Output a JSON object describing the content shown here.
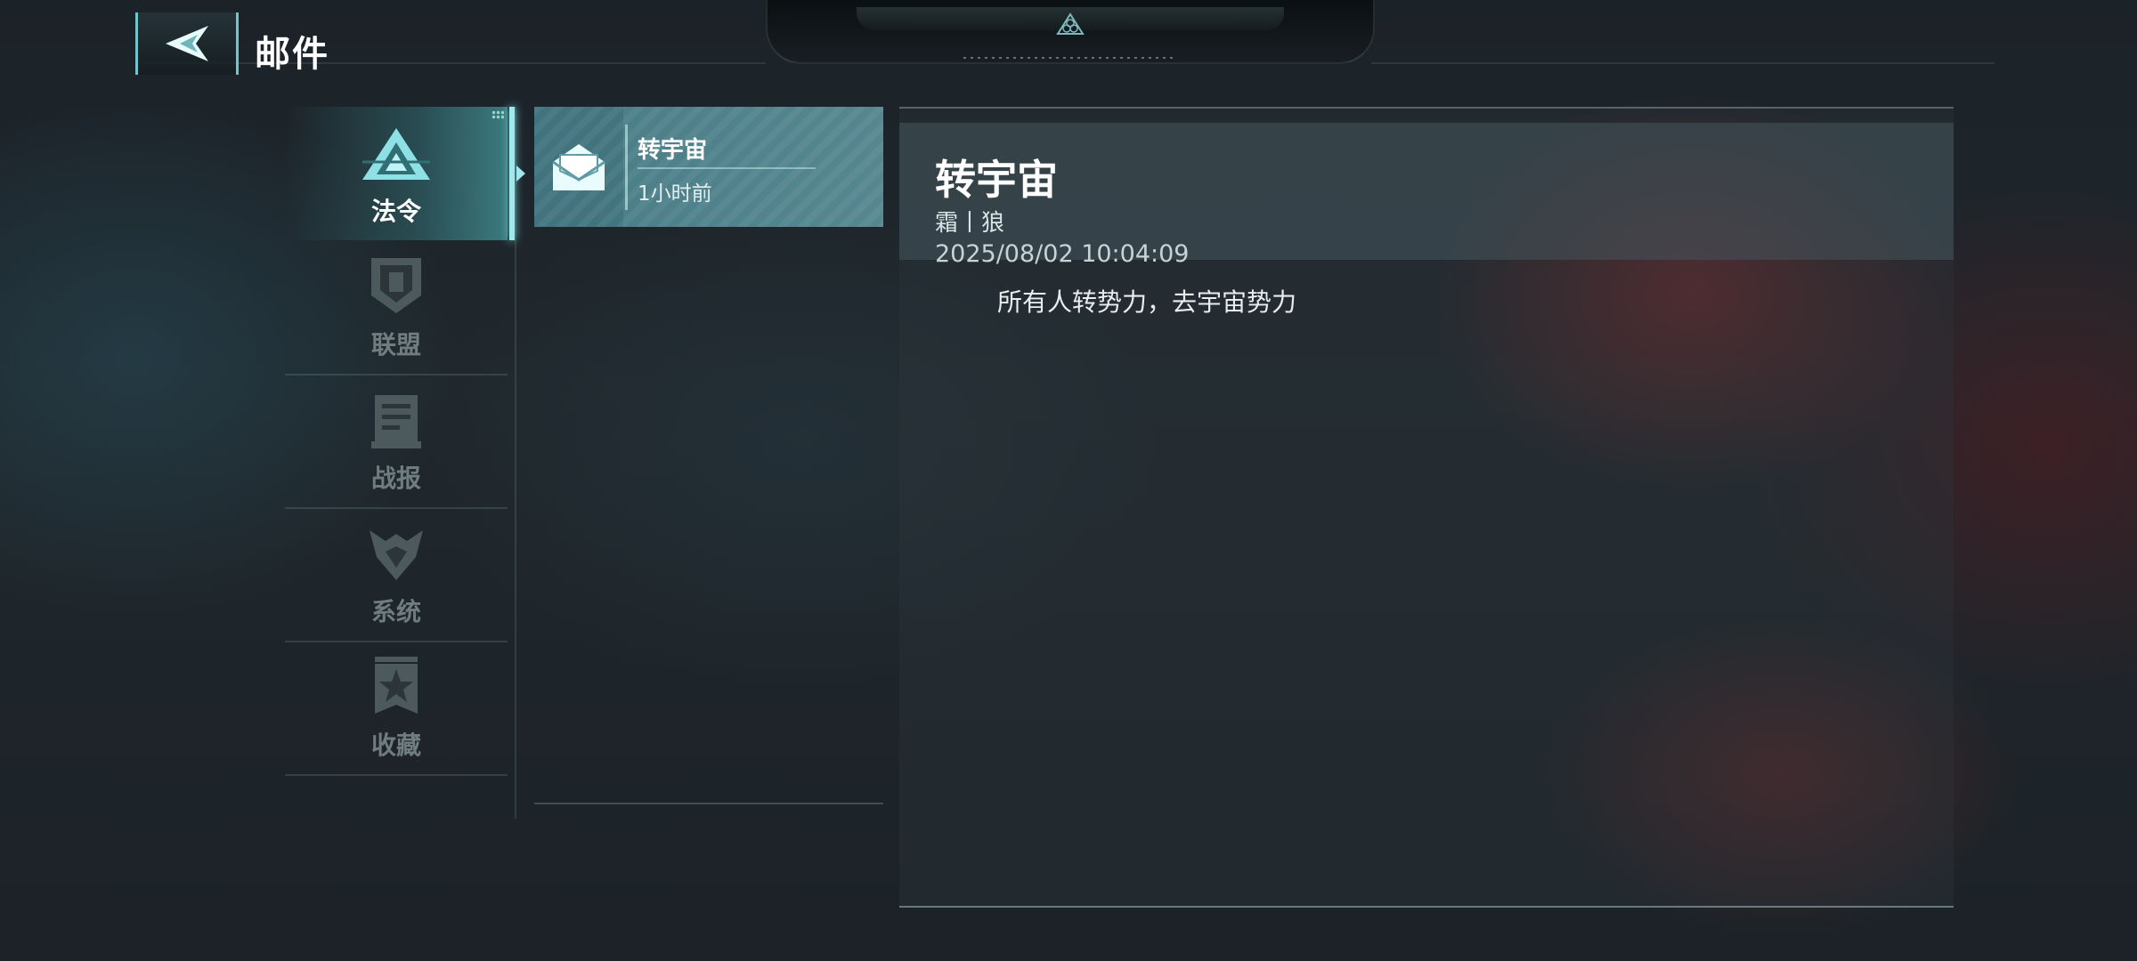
{
  "header": {
    "title": "邮件",
    "back_icon": "back-arrow-icon"
  },
  "sidebar": {
    "tabs": [
      {
        "label": "法令",
        "icon": "decree-triangle-icon",
        "active": true
      },
      {
        "label": "联盟",
        "icon": "alliance-shield-icon",
        "active": false
      },
      {
        "label": "战报",
        "icon": "battle-report-document-icon",
        "active": false
      },
      {
        "label": "系统",
        "icon": "system-emblem-icon",
        "active": false
      },
      {
        "label": "收藏",
        "icon": "favorites-star-icon",
        "active": false
      }
    ]
  },
  "mail_list": {
    "items": [
      {
        "subject": "转宇宙",
        "time": "1小时前",
        "icon": "envelope-icon",
        "selected": true
      }
    ]
  },
  "detail": {
    "title": "转宇宙",
    "sender": "霜丨狼",
    "date": "2025/08/02  10:04:09",
    "body": "所有人转势力，去宇宙势力"
  },
  "colors": {
    "accent": "#9fe8ec",
    "selected_item": "#5a9aa4",
    "inactive_tab": "#6f7d80"
  }
}
